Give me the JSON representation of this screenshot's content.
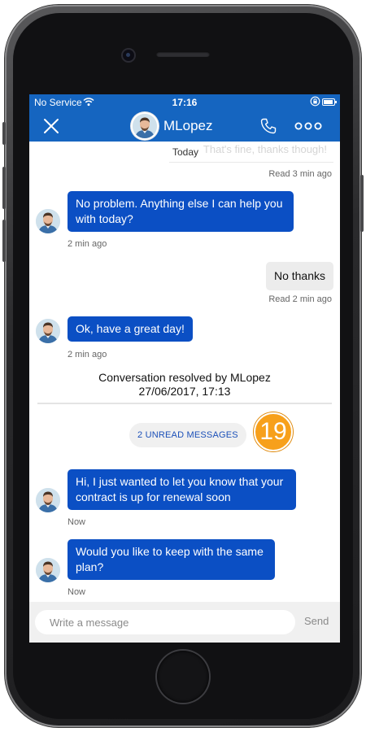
{
  "status_bar": {
    "carrier": "No Service",
    "time": "17:16"
  },
  "header": {
    "title": "MLopez"
  },
  "chat": {
    "faded_previous": "That's fine, thanks though!",
    "date_divider": "Today",
    "previous_status": "Read  3 min ago",
    "messages": [
      {
        "direction": "in",
        "text": "No problem. Anything else I can help you with today?",
        "time": "2 min ago"
      },
      {
        "direction": "out",
        "text": "No thanks",
        "time": "Read  2 min ago"
      },
      {
        "direction": "in",
        "text": "Ok, have a great day!",
        "time": "2 min ago"
      },
      {
        "direction": "in",
        "text": "Hi, I just wanted to let you know that your contract is up for renewal soon",
        "time": "Now"
      },
      {
        "direction": "in",
        "text": "Would you like to keep with the same plan?",
        "time": "Now"
      }
    ],
    "resolved_line1": "Conversation resolved by MLopez",
    "resolved_line2": "27/06/2017, 17:13",
    "unread_label": "2 UNREAD MESSAGES",
    "unread_badge": "19"
  },
  "composer": {
    "placeholder": "Write a message",
    "send_label": "Send"
  },
  "colors": {
    "brand_blue": "#1565c0",
    "incoming_bubble": "#0b4fc4",
    "outgoing_bubble": "#ececec",
    "badge_orange": "#f7a01b"
  },
  "icons": [
    "close-icon",
    "phone-icon",
    "more-icon",
    "wifi-icon",
    "lock-rotation-icon",
    "battery-icon"
  ]
}
